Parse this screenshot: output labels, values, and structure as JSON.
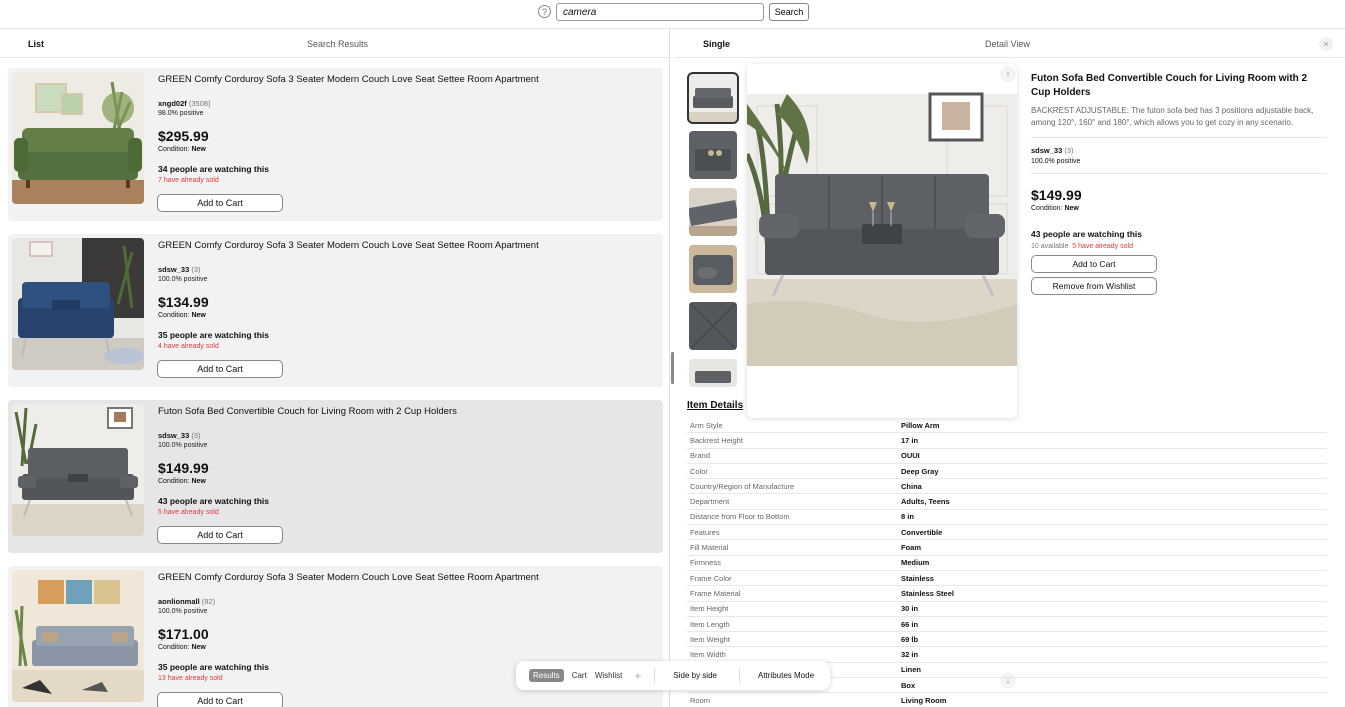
{
  "search": {
    "value": "camera",
    "button_label": "Search",
    "help_glyph": "?"
  },
  "left_pane": {
    "mode_label": "List",
    "title": "Search Results"
  },
  "right_pane": {
    "mode_label": "Single",
    "title": "Detail View",
    "close_glyph": "×"
  },
  "results": [
    {
      "title": "GREEN Comfy Corduroy Sofa 3 Seater Modern Couch Love Seat Settee Room Apartment",
      "seller": "xngd02f",
      "feedback": "(3508)",
      "positive": "98.0% positive",
      "price": "$295.99",
      "condition_label": "Condition:",
      "condition": "New",
      "watching": "34 people are watching this",
      "sold": "7 have already sold",
      "cart_label": "Add to Cart"
    },
    {
      "title": "GREEN Comfy Corduroy Sofa 3 Seater Modern Couch Love Seat Settee Room Apartment",
      "seller": "sdsw_33",
      "feedback": "(3)",
      "positive": "100.0% positive",
      "price": "$134.99",
      "condition_label": "Condition:",
      "condition": "New",
      "watching": "35 people are watching this",
      "sold": "4 have already sold",
      "cart_label": "Add to Cart"
    },
    {
      "title": "Futon Sofa Bed Convertible Couch for Living Room with 2 Cup Holders",
      "seller": "sdsw_33",
      "feedback": "(3)",
      "positive": "100.0% positive",
      "price": "$149.99",
      "condition_label": "Condition:",
      "condition": "New",
      "watching": "43 people are watching this",
      "sold": "5 have already sold",
      "cart_label": "Add to Cart"
    },
    {
      "title": "GREEN Comfy Corduroy Sofa 3 Seater Modern Couch Love Seat Settee Room Apartment",
      "seller": "aonlionmall",
      "feedback": "(82)",
      "positive": "100.0% positive",
      "price": "$171.00",
      "condition_label": "Condition:",
      "condition": "New",
      "watching": "35 people are watching this",
      "sold": "13 have already sold",
      "cart_label": "Add to Cart"
    }
  ],
  "detail": {
    "title": "Futon Sofa Bed Convertible Couch for Living Room with 2 Cup Holders",
    "description": "BACKREST ADJUSTABLE: The futon sofa bed has 3 positions adjustable back, among 120°, 160° and 180°, which allows you to get cozy in any scenario.",
    "seller": "sdsw_33",
    "feedback": "(3)",
    "positive": "100.0% positive",
    "price": "$149.99",
    "condition_label": "Condition:",
    "condition": "New",
    "watching": "43 people are watching this",
    "available": "10 available",
    "sold": "5 have already sold",
    "cart_label": "Add to Cart",
    "wishlist_label": "Remove from Wishlist",
    "item_details_heading": "Item Details",
    "specs": [
      {
        "k": "Arm Style",
        "v": "Pillow Arm"
      },
      {
        "k": "Backrest Height",
        "v": "17 in"
      },
      {
        "k": "Brand",
        "v": "OUUI"
      },
      {
        "k": "Color",
        "v": "Deep Gray"
      },
      {
        "k": "Country/Region of Manufacture",
        "v": "China"
      },
      {
        "k": "Department",
        "v": "Adults, Teens"
      },
      {
        "k": "Distance from Floor to Bottom",
        "v": "8 in"
      },
      {
        "k": "Features",
        "v": "Convertible"
      },
      {
        "k": "Fill Material",
        "v": "Foam"
      },
      {
        "k": "Firmness",
        "v": "Medium"
      },
      {
        "k": "Frame Color",
        "v": "Stainless"
      },
      {
        "k": "Frame Material",
        "v": "Stainless Steel"
      },
      {
        "k": "Item Height",
        "v": "30 in"
      },
      {
        "k": "Item Length",
        "v": "66 in"
      },
      {
        "k": "Item Weight",
        "v": "69 lb"
      },
      {
        "k": "Item Width",
        "v": "32 in"
      },
      {
        "k": "",
        "v": "Linen"
      },
      {
        "k": "",
        "v": "Box"
      },
      {
        "k": "Room",
        "v": "Living Room"
      }
    ]
  },
  "toolbar": {
    "results_label": "Results",
    "cart_label": "Cart",
    "wishlist_label": "Wishlist",
    "plus_glyph": "+",
    "side_by_side_label": "Side by side",
    "attributes_label": "Attributes Mode"
  },
  "arrows": {
    "up": "↑",
    "down": "↓"
  },
  "colors": {
    "sold_red": "#e03a3a",
    "card_bg": "#f2f2f3",
    "card_selected_bg": "#e6e6e8"
  }
}
